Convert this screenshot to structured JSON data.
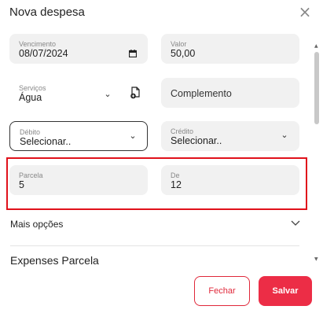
{
  "dialog": {
    "title": "Nova despesa",
    "close_icon": "close-icon"
  },
  "form": {
    "vencimento": {
      "label": "Vencimento",
      "value": "08/07/2024",
      "icon": "calendar-icon"
    },
    "valor": {
      "label": "Valor",
      "value": "50,00"
    },
    "servicos": {
      "label": "Serviços",
      "value": "Água",
      "icon": "document-add-icon"
    },
    "complemento": {
      "placeholder": "Complemento"
    },
    "debito": {
      "label": "Débito",
      "value": "Selecionar.."
    },
    "credito": {
      "label": "Crédito",
      "value": "Selecionar.."
    },
    "parcela": {
      "label": "Parcela",
      "value": "5"
    },
    "de": {
      "label": "De",
      "value": "12"
    }
  },
  "more_options": {
    "label": "Mais opções"
  },
  "section": {
    "title": "Expenses Parcela"
  },
  "footer": {
    "cancel_label": "Fechar",
    "save_label": "Salvar"
  },
  "colors": {
    "accent": "#ec2d46",
    "highlight_border": "#e0111b",
    "field_bg": "#f1f1f1"
  }
}
